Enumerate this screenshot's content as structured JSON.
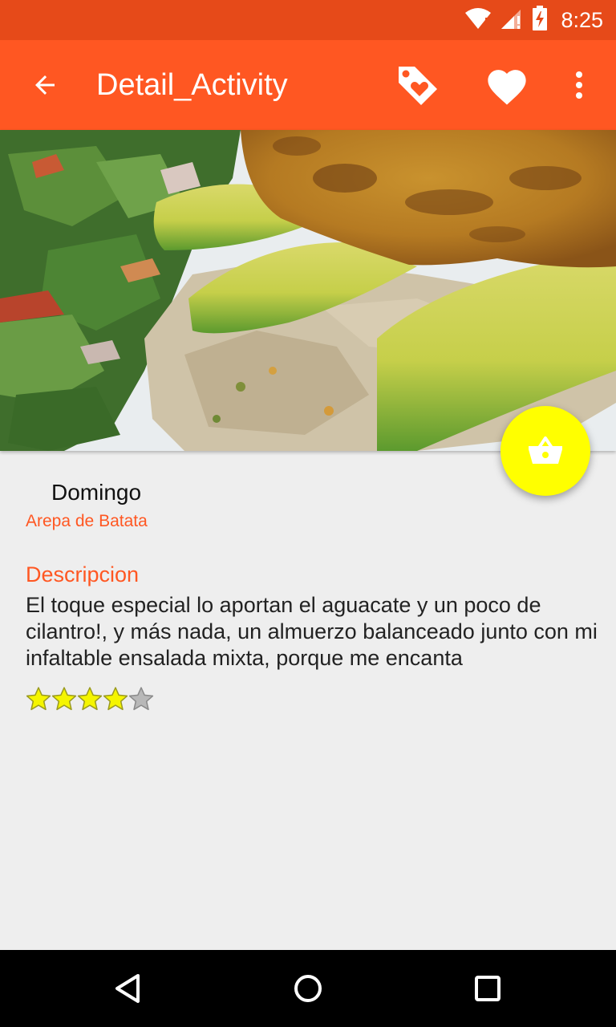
{
  "status_bar": {
    "time": "8:25",
    "icons": [
      "wifi-icon",
      "signal-icon",
      "battery-charging-icon"
    ]
  },
  "app_bar": {
    "title": "Detail_Activity",
    "nav_icon": "back-arrow-icon",
    "actions": [
      "tag-heart-icon",
      "heart-icon",
      "more-vert-icon"
    ]
  },
  "hero": {
    "image": "photo of arepa with avocado, shredded chicken and mixed salad"
  },
  "fab": {
    "icon": "basket-icon",
    "color": "#ffff00"
  },
  "detail": {
    "day": "Domingo",
    "recipe_name": "Arepa de Batata",
    "description_heading": "Descripcion",
    "description": "El toque especial lo aportan el aguacate y un poco de cilantro!, y más nada, un almuerzo balanceado junto con mi infaltable ensalada mixta, porque me encanta",
    "rating": 4,
    "rating_max": 5
  },
  "colors": {
    "primary": "#ff5722",
    "primary_dark": "#e64a19",
    "accent": "#ffff00",
    "background": "#eeeeee"
  }
}
